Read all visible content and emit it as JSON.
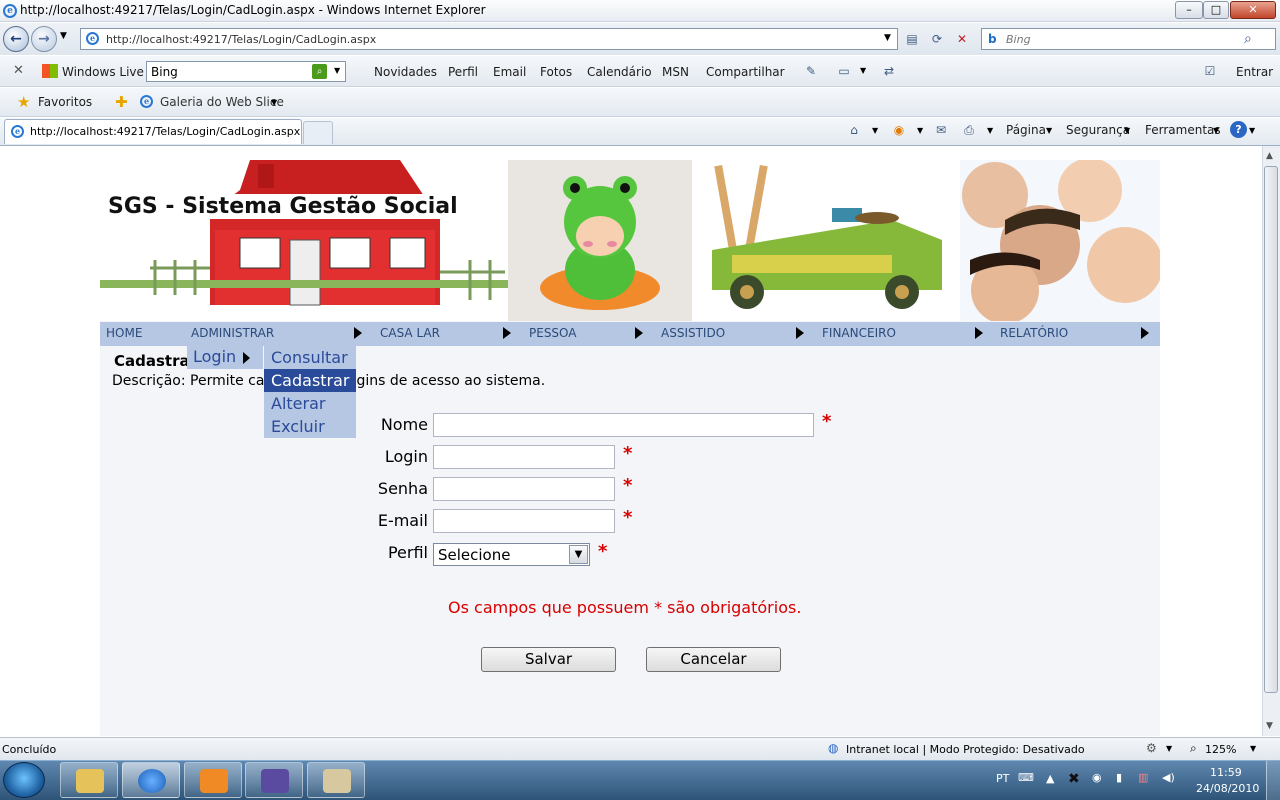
{
  "window": {
    "title": "http://localhost:49217/Telas/Login/CadLogin.aspx - Windows Internet Explorer",
    "min": "–",
    "max": "□",
    "close": "✕"
  },
  "address": {
    "url": "http://localhost:49217/Telas/Login/CadLogin.aspx",
    "search_placeholder": "Bing"
  },
  "toolbar": {
    "windows_live": "Windows Live",
    "search_value": "Bing",
    "links": [
      "Novidades",
      "Perfil",
      "Email",
      "Fotos",
      "Calendário",
      "MSN",
      "Compartilhar"
    ],
    "signin": "Entrar"
  },
  "favorites": {
    "label": "Favoritos",
    "webslice": "Galeria do Web Slice"
  },
  "tab": {
    "title": "http://localhost:49217/Telas/Login/CadLogin.aspx"
  },
  "commands": {
    "pagina": "Página",
    "seguranca": "Segurança",
    "ferramentas": "Ferramentas"
  },
  "banner": {
    "title": "SGS - Sistema Gestão Social"
  },
  "menu": {
    "items": [
      "HOME",
      "ADMINISTRAR",
      "CASA LAR",
      "PESSOA",
      "ASSISTIDO",
      "FINANCEIRO",
      "RELATÓRIO"
    ],
    "sub": {
      "login": "Login",
      "options": [
        "Consultar",
        "Cadastrar",
        "Alterar",
        "Excluir"
      ],
      "selected": "Cadastrar"
    }
  },
  "form": {
    "title": "Cadastra",
    "description_prefix": "Descrição: Permite ca",
    "description_suffix": "gins de acesso ao sistema.",
    "fields": {
      "nome": "Nome",
      "login": "Login",
      "senha": "Senha",
      "email": "E-mail",
      "perfil": "Perfil"
    },
    "perfil_value": "Selecione",
    "required_mark": "*",
    "note": "Os campos que possuem * são obrigatórios.",
    "save": "Salvar",
    "cancel": "Cancelar"
  },
  "status": {
    "left": "Concluído",
    "zone": "Intranet local | Modo Protegido: Desativado",
    "zoom": "125%"
  },
  "taskbar": {
    "lang": "PT",
    "time": "11:59",
    "date": "24/08/2010"
  },
  "colors": {
    "menu_bg": "#b6c7e3",
    "menu_text": "#2a4a7a",
    "submenu_selected": "#294b99",
    "required": "#d80000"
  }
}
